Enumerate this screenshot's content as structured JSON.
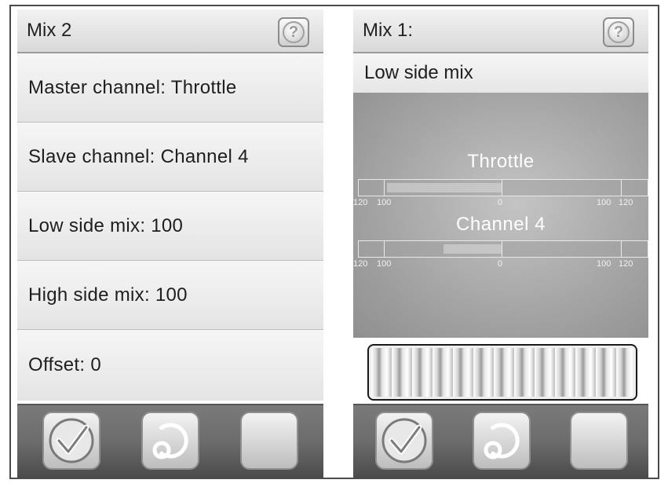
{
  "left_screen": {
    "title": "Mix 2",
    "menu": [
      {
        "label": "Master channel: Throttle"
      },
      {
        "label": "Slave channel: Channel 4"
      },
      {
        "label": "Low side mix: 100"
      },
      {
        "label": "High side mix: 100"
      },
      {
        "label": "Offset: 0"
      }
    ],
    "help_icon": "question-mark-icon"
  },
  "right_screen": {
    "title": "Mix 1:",
    "subtitle": "Low side mix",
    "help_icon": "question-mark-icon",
    "monitors": [
      {
        "label": "Throttle",
        "scale": {
          "left_outer": "120",
          "left_inner": "100",
          "center": "0",
          "right_inner": "100",
          "right_outer": "120"
        }
      },
      {
        "label": "Channel 4",
        "scale": {
          "left_outer": "120",
          "left_inner": "100",
          "center": "0",
          "right_inner": "100",
          "right_outer": "120"
        }
      }
    ]
  },
  "bottom_bar": {
    "buttons": [
      "check-icon",
      "undo-icon",
      "blank-button"
    ]
  },
  "colors": {
    "monitor_bg": "#a6a6a6",
    "bottom_bar": "#6c6c6c",
    "frame": "#4a4a4a"
  }
}
